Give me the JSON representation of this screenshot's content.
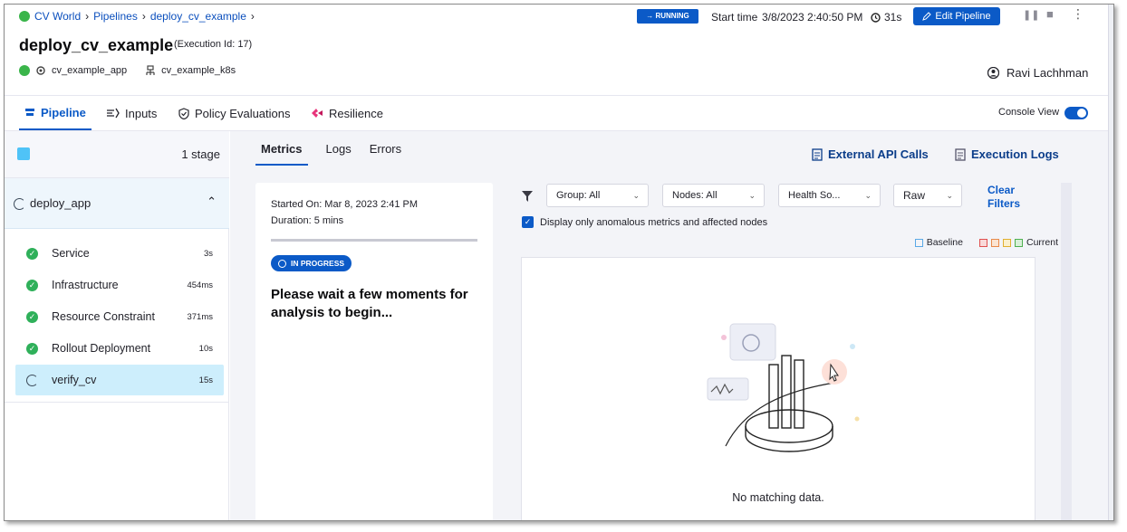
{
  "breadcrumb": {
    "root": "CV World",
    "pipelines": "Pipelines",
    "current": "deploy_cv_example"
  },
  "header": {
    "title": "deploy_cv_example",
    "execution_id": "(Execution Id: 17)",
    "service": "cv_example_app",
    "environment": "cv_example_k8s",
    "status": "→ RUNNING",
    "start_label": "Start time",
    "start_value": "3/8/2023 2:40:50 PM",
    "elapsed": "31s",
    "edit_label": "Edit Pipeline",
    "user": "Ravi Lachhman"
  },
  "tabs": [
    {
      "label": "Pipeline",
      "icon": "pipeline-icon"
    },
    {
      "label": "Inputs",
      "icon": "inputs-icon"
    },
    {
      "label": "Policy Evaluations",
      "icon": "policy-icon"
    },
    {
      "label": "Resilience",
      "icon": "resilience-icon"
    }
  ],
  "console_view": "Console View",
  "stages": {
    "count": "1 stage",
    "stage_name": "deploy_app",
    "steps": [
      {
        "name": "Service",
        "duration": "3s"
      },
      {
        "name": "Infrastructure",
        "duration": "454ms"
      },
      {
        "name": "Resource Constraint",
        "duration": "371ms"
      },
      {
        "name": "Rollout Deployment",
        "duration": "10s"
      },
      {
        "name": "verify_cv",
        "duration": "15s"
      }
    ]
  },
  "subtabs": [
    "Metrics",
    "Logs",
    "Errors"
  ],
  "links": {
    "external_api": "External API Calls",
    "execution_logs": "Execution Logs"
  },
  "analysis": {
    "started": "Started On: Mar 8, 2023 2:41 PM",
    "duration": "Duration: 5 mins",
    "status": "IN PROGRESS",
    "message": "Please wait a few moments for analysis to begin..."
  },
  "filters": {
    "group": "Group: All",
    "nodes": "Nodes: All",
    "health": "Health So...",
    "view": "Raw",
    "clear": "Clear Filters",
    "checkbox": "Display only anomalous metrics and affected nodes"
  },
  "legend": {
    "baseline": "Baseline",
    "current": "Current"
  },
  "empty_message": "No matching data.",
  "colors": {
    "primary": "#0b5ac7",
    "success": "#2fb05a",
    "accent": "#e8337a"
  }
}
